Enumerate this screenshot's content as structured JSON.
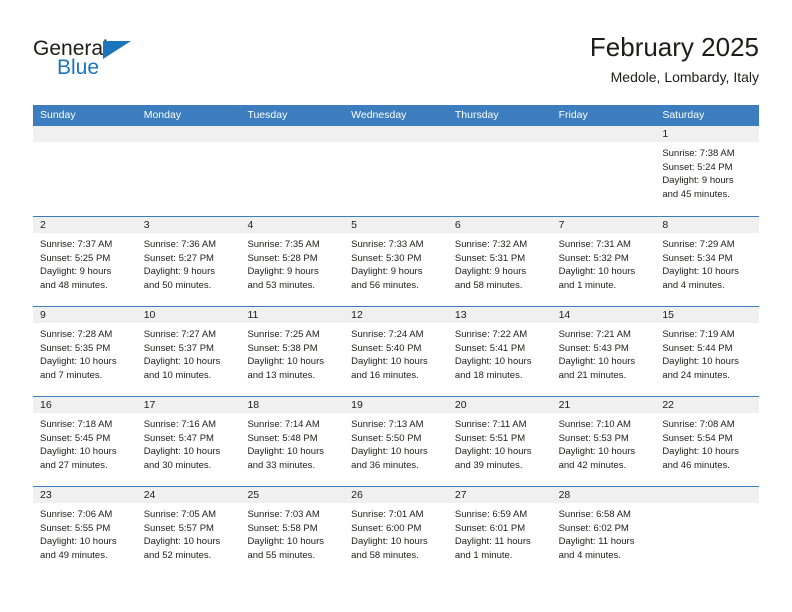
{
  "brand": {
    "name_part1": "General",
    "name_part2": "Blue",
    "logo_icon": "triangle-logo-icon"
  },
  "header": {
    "title": "February 2025",
    "subtitle": "Medole, Lombardy, Italy"
  },
  "colors": {
    "header_blue": "#3b7dbf",
    "brand_blue": "#1b75bb",
    "day_strip_gray": "#f0f0f0",
    "text": "#1d1d1b"
  },
  "weekdays": [
    "Sunday",
    "Monday",
    "Tuesday",
    "Wednesday",
    "Thursday",
    "Friday",
    "Saturday"
  ],
  "labels": {
    "sunrise": "Sunrise:",
    "sunset": "Sunset:",
    "daylight": "Daylight:"
  },
  "weeks": [
    [
      {
        "empty": true
      },
      {
        "empty": true
      },
      {
        "empty": true
      },
      {
        "empty": true
      },
      {
        "empty": true
      },
      {
        "empty": true
      },
      {
        "day": "1",
        "sunrise": "Sunrise: 7:38 AM",
        "sunset": "Sunset: 5:24 PM",
        "daylight_1": "Daylight: 9 hours",
        "daylight_2": "and 45 minutes."
      }
    ],
    [
      {
        "day": "2",
        "sunrise": "Sunrise: 7:37 AM",
        "sunset": "Sunset: 5:25 PM",
        "daylight_1": "Daylight: 9 hours",
        "daylight_2": "and 48 minutes."
      },
      {
        "day": "3",
        "sunrise": "Sunrise: 7:36 AM",
        "sunset": "Sunset: 5:27 PM",
        "daylight_1": "Daylight: 9 hours",
        "daylight_2": "and 50 minutes."
      },
      {
        "day": "4",
        "sunrise": "Sunrise: 7:35 AM",
        "sunset": "Sunset: 5:28 PM",
        "daylight_1": "Daylight: 9 hours",
        "daylight_2": "and 53 minutes."
      },
      {
        "day": "5",
        "sunrise": "Sunrise: 7:33 AM",
        "sunset": "Sunset: 5:30 PM",
        "daylight_1": "Daylight: 9 hours",
        "daylight_2": "and 56 minutes."
      },
      {
        "day": "6",
        "sunrise": "Sunrise: 7:32 AM",
        "sunset": "Sunset: 5:31 PM",
        "daylight_1": "Daylight: 9 hours",
        "daylight_2": "and 58 minutes."
      },
      {
        "day": "7",
        "sunrise": "Sunrise: 7:31 AM",
        "sunset": "Sunset: 5:32 PM",
        "daylight_1": "Daylight: 10 hours",
        "daylight_2": "and 1 minute."
      },
      {
        "day": "8",
        "sunrise": "Sunrise: 7:29 AM",
        "sunset": "Sunset: 5:34 PM",
        "daylight_1": "Daylight: 10 hours",
        "daylight_2": "and 4 minutes."
      }
    ],
    [
      {
        "day": "9",
        "sunrise": "Sunrise: 7:28 AM",
        "sunset": "Sunset: 5:35 PM",
        "daylight_1": "Daylight: 10 hours",
        "daylight_2": "and 7 minutes."
      },
      {
        "day": "10",
        "sunrise": "Sunrise: 7:27 AM",
        "sunset": "Sunset: 5:37 PM",
        "daylight_1": "Daylight: 10 hours",
        "daylight_2": "and 10 minutes."
      },
      {
        "day": "11",
        "sunrise": "Sunrise: 7:25 AM",
        "sunset": "Sunset: 5:38 PM",
        "daylight_1": "Daylight: 10 hours",
        "daylight_2": "and 13 minutes."
      },
      {
        "day": "12",
        "sunrise": "Sunrise: 7:24 AM",
        "sunset": "Sunset: 5:40 PM",
        "daylight_1": "Daylight: 10 hours",
        "daylight_2": "and 16 minutes."
      },
      {
        "day": "13",
        "sunrise": "Sunrise: 7:22 AM",
        "sunset": "Sunset: 5:41 PM",
        "daylight_1": "Daylight: 10 hours",
        "daylight_2": "and 18 minutes."
      },
      {
        "day": "14",
        "sunrise": "Sunrise: 7:21 AM",
        "sunset": "Sunset: 5:43 PM",
        "daylight_1": "Daylight: 10 hours",
        "daylight_2": "and 21 minutes."
      },
      {
        "day": "15",
        "sunrise": "Sunrise: 7:19 AM",
        "sunset": "Sunset: 5:44 PM",
        "daylight_1": "Daylight: 10 hours",
        "daylight_2": "and 24 minutes."
      }
    ],
    [
      {
        "day": "16",
        "sunrise": "Sunrise: 7:18 AM",
        "sunset": "Sunset: 5:45 PM",
        "daylight_1": "Daylight: 10 hours",
        "daylight_2": "and 27 minutes."
      },
      {
        "day": "17",
        "sunrise": "Sunrise: 7:16 AM",
        "sunset": "Sunset: 5:47 PM",
        "daylight_1": "Daylight: 10 hours",
        "daylight_2": "and 30 minutes."
      },
      {
        "day": "18",
        "sunrise": "Sunrise: 7:14 AM",
        "sunset": "Sunset: 5:48 PM",
        "daylight_1": "Daylight: 10 hours",
        "daylight_2": "and 33 minutes."
      },
      {
        "day": "19",
        "sunrise": "Sunrise: 7:13 AM",
        "sunset": "Sunset: 5:50 PM",
        "daylight_1": "Daylight: 10 hours",
        "daylight_2": "and 36 minutes."
      },
      {
        "day": "20",
        "sunrise": "Sunrise: 7:11 AM",
        "sunset": "Sunset: 5:51 PM",
        "daylight_1": "Daylight: 10 hours",
        "daylight_2": "and 39 minutes."
      },
      {
        "day": "21",
        "sunrise": "Sunrise: 7:10 AM",
        "sunset": "Sunset: 5:53 PM",
        "daylight_1": "Daylight: 10 hours",
        "daylight_2": "and 42 minutes."
      },
      {
        "day": "22",
        "sunrise": "Sunrise: 7:08 AM",
        "sunset": "Sunset: 5:54 PM",
        "daylight_1": "Daylight: 10 hours",
        "daylight_2": "and 46 minutes."
      }
    ],
    [
      {
        "day": "23",
        "sunrise": "Sunrise: 7:06 AM",
        "sunset": "Sunset: 5:55 PM",
        "daylight_1": "Daylight: 10 hours",
        "daylight_2": "and 49 minutes."
      },
      {
        "day": "24",
        "sunrise": "Sunrise: 7:05 AM",
        "sunset": "Sunset: 5:57 PM",
        "daylight_1": "Daylight: 10 hours",
        "daylight_2": "and 52 minutes."
      },
      {
        "day": "25",
        "sunrise": "Sunrise: 7:03 AM",
        "sunset": "Sunset: 5:58 PM",
        "daylight_1": "Daylight: 10 hours",
        "daylight_2": "and 55 minutes."
      },
      {
        "day": "26",
        "sunrise": "Sunrise: 7:01 AM",
        "sunset": "Sunset: 6:00 PM",
        "daylight_1": "Daylight: 10 hours",
        "daylight_2": "and 58 minutes."
      },
      {
        "day": "27",
        "sunrise": "Sunrise: 6:59 AM",
        "sunset": "Sunset: 6:01 PM",
        "daylight_1": "Daylight: 11 hours",
        "daylight_2": "and 1 minute."
      },
      {
        "day": "28",
        "sunrise": "Sunrise: 6:58 AM",
        "sunset": "Sunset: 6:02 PM",
        "daylight_1": "Daylight: 11 hours",
        "daylight_2": "and 4 minutes."
      },
      {
        "empty": true
      }
    ]
  ]
}
